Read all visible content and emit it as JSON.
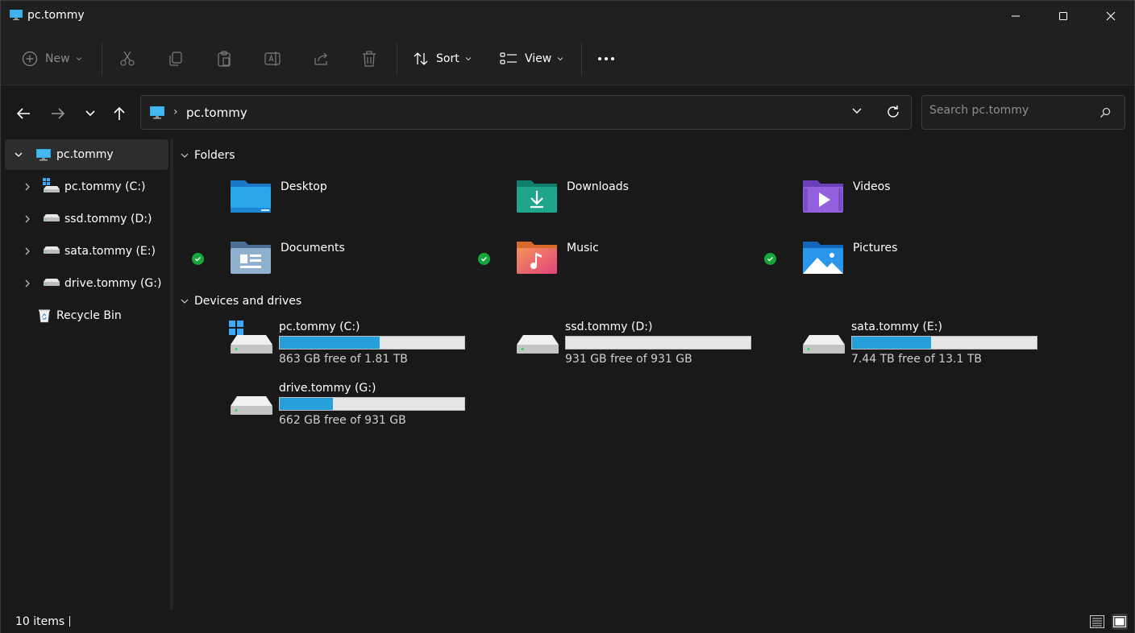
{
  "window": {
    "title": "pc.tommy"
  },
  "toolbar": {
    "new_label": "New",
    "sort_label": "Sort",
    "view_label": "View"
  },
  "address": {
    "crumb": "pc.tommy",
    "search_placeholder": "Search pc.tommy"
  },
  "sidebar": {
    "items": [
      {
        "label": "pc.tommy"
      },
      {
        "label": "pc.tommy (C:)"
      },
      {
        "label": "ssd.tommy (D:)"
      },
      {
        "label": "sata.tommy (E:)"
      },
      {
        "label": "drive.tommy (G:)"
      },
      {
        "label": "Recycle Bin"
      }
    ]
  },
  "sections": {
    "folders": "Folders",
    "drives": "Devices and drives"
  },
  "folders": [
    {
      "name": "Desktop",
      "icon": "desktop-folder-icon",
      "synced": false
    },
    {
      "name": "Downloads",
      "icon": "downloads-folder-icon",
      "synced": false
    },
    {
      "name": "Videos",
      "icon": "videos-folder-icon",
      "synced": false
    },
    {
      "name": "Documents",
      "icon": "documents-folder-icon",
      "synced": true
    },
    {
      "name": "Music",
      "icon": "music-folder-icon",
      "synced": true
    },
    {
      "name": "Pictures",
      "icon": "pictures-folder-icon",
      "synced": true
    }
  ],
  "drives": [
    {
      "name": "pc.tommy (C:)",
      "free": "863 GB free of 1.81 TB",
      "used_fraction": 0.54,
      "system": true
    },
    {
      "name": "ssd.tommy (D:)",
      "free": "931 GB free of 931 GB",
      "used_fraction": 0.0,
      "system": false
    },
    {
      "name": "sata.tommy (E:)",
      "free": "7.44 TB free of 13.1 TB",
      "used_fraction": 0.43,
      "system": false
    },
    {
      "name": "drive.tommy (G:)",
      "free": "662 GB free of 931 GB",
      "used_fraction": 0.29,
      "system": false
    }
  ],
  "status": {
    "count": "10 items"
  },
  "colors": {
    "accent": "#26a0da",
    "sync_green": "#15a63c"
  }
}
